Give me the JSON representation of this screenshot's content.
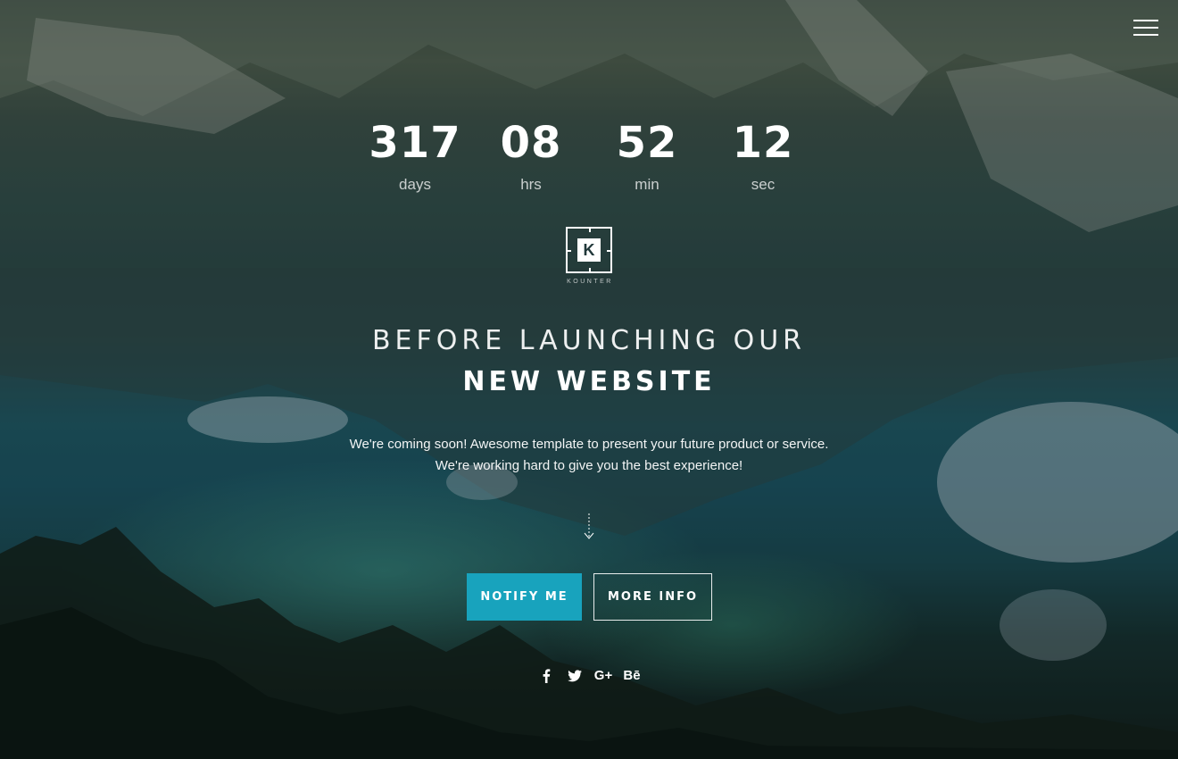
{
  "menu": {
    "icon": "hamburger-menu-icon"
  },
  "countdown": {
    "units": [
      {
        "value": "317",
        "label": "days"
      },
      {
        "value": "08",
        "label": "hrs"
      },
      {
        "value": "52",
        "label": "min"
      },
      {
        "value": "12",
        "label": "sec"
      }
    ]
  },
  "logo": {
    "letter": "K",
    "wordmark": "KOUNTER"
  },
  "headline": {
    "line1": "BEFORE LAUNCHING OUR",
    "line2": "NEW WEBSITE"
  },
  "description": {
    "line1": "We're coming soon! Awesome template to present your future product or service.",
    "line2": "We're working hard to give you the best experience!"
  },
  "scroll": {
    "icon": "dashed-arrow-down-icon"
  },
  "buttons": {
    "notify": "NOTIFY ME",
    "more": "MORE INFO"
  },
  "social": [
    {
      "icon": "facebook-icon",
      "glyph": "f"
    },
    {
      "icon": "twitter-icon",
      "glyph": "🐦"
    },
    {
      "icon": "google-plus-icon",
      "glyph": "G+"
    },
    {
      "icon": "behance-icon",
      "glyph": "Bē"
    }
  ],
  "colors": {
    "accent": "#18a3bd",
    "text": "#ffffff"
  }
}
